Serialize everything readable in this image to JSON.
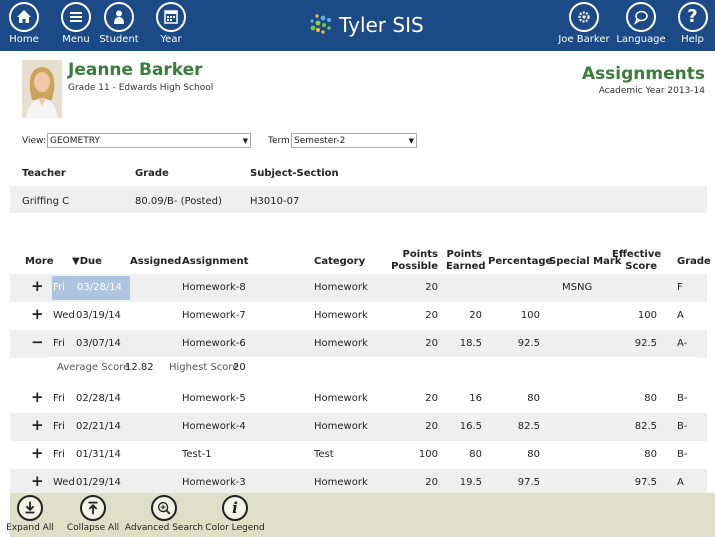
{
  "nav": {
    "home": "Home",
    "menu": "Menu",
    "student": "Student",
    "year": "Year",
    "user": "Joe Barker",
    "language": "Language",
    "help": "Help"
  },
  "brand": {
    "name": "Tyler SIS"
  },
  "student": {
    "name": "Jeanne Barker",
    "subtitle": "Grade 11 - Edwards High School"
  },
  "page": {
    "title": "Assignments",
    "subtitle": "Academic Year 2013-14"
  },
  "filters": {
    "view_label": "View:",
    "view_value": "GEOMETRY",
    "term_label": "Term",
    "term_value": "Semester-2"
  },
  "course": {
    "headers": {
      "teacher": "Teacher",
      "grade": "Grade",
      "section": "Subject-Section"
    },
    "teacher": "Griffing C",
    "grade": "80.09/B- (Posted)",
    "section": "H3010-07"
  },
  "table": {
    "headers": {
      "more": "More",
      "due": "▼Due",
      "assigned": "Assigned",
      "assignment": "Assignment",
      "category": "Category",
      "points_possible_1": "Points",
      "points_possible_2": "Possible",
      "points_earned_1": "Points",
      "points_earned_2": "Earned",
      "percentage": "Percentage",
      "special_mark": "Special Mark",
      "effective_1": "Effective",
      "effective_2": "Score",
      "grade": "Grade"
    },
    "rows": [
      {
        "toggle": "+",
        "day": "Fri",
        "date": "03/28/14",
        "assignment": "Homework-8",
        "category": "Homework",
        "possible": "20",
        "earned": "",
        "percentage": "",
        "special": "MSNG",
        "effective": "",
        "grade": "F"
      },
      {
        "toggle": "+",
        "day": "Wed",
        "date": "03/19/14",
        "assignment": "Homework-7",
        "category": "Homework",
        "possible": "20",
        "earned": "20",
        "percentage": "100",
        "special": "",
        "effective": "100",
        "grade": "A"
      },
      {
        "toggle": "−",
        "day": "Fri",
        "date": "03/07/14",
        "assignment": "Homework-6",
        "category": "Homework",
        "possible": "20",
        "earned": "18.5",
        "percentage": "92.5",
        "special": "",
        "effective": "92.5",
        "grade": "A-"
      },
      {
        "toggle": "+",
        "day": "Fri",
        "date": "02/28/14",
        "assignment": "Homework-5",
        "category": "Homework",
        "possible": "20",
        "earned": "16",
        "percentage": "80",
        "special": "",
        "effective": "80",
        "grade": "B-"
      },
      {
        "toggle": "+",
        "day": "Fri",
        "date": "02/21/14",
        "assignment": "Homework-4",
        "category": "Homework",
        "possible": "20",
        "earned": "16.5",
        "percentage": "82.5",
        "special": "",
        "effective": "82.5",
        "grade": "B-"
      },
      {
        "toggle": "+",
        "day": "Fri",
        "date": "01/31/14",
        "assignment": "Test-1",
        "category": "Test",
        "possible": "100",
        "earned": "80",
        "percentage": "80",
        "special": "",
        "effective": "80",
        "grade": "B-"
      },
      {
        "toggle": "+",
        "day": "Wed",
        "date": "01/29/14",
        "assignment": "Homework-3",
        "category": "Homework",
        "possible": "20",
        "earned": "19.5",
        "percentage": "97.5",
        "special": "",
        "effective": "97.5",
        "grade": "A"
      }
    ],
    "detail": {
      "avg_label": "Average Score",
      "avg_value": "12.82",
      "high_label": "Highest Score",
      "high_value": "20"
    }
  },
  "toolbar": {
    "expand_all": "Expand All",
    "collapse_all": "Collapse All",
    "advanced_search": "Advanced Search",
    "color_legend": "Color Legend"
  },
  "colors": {
    "topbar": "#1c4a86",
    "accent_green": "#3a7d3a",
    "row_highlight": "#aec4e0",
    "toolbar_bg": "#dde0c6"
  }
}
